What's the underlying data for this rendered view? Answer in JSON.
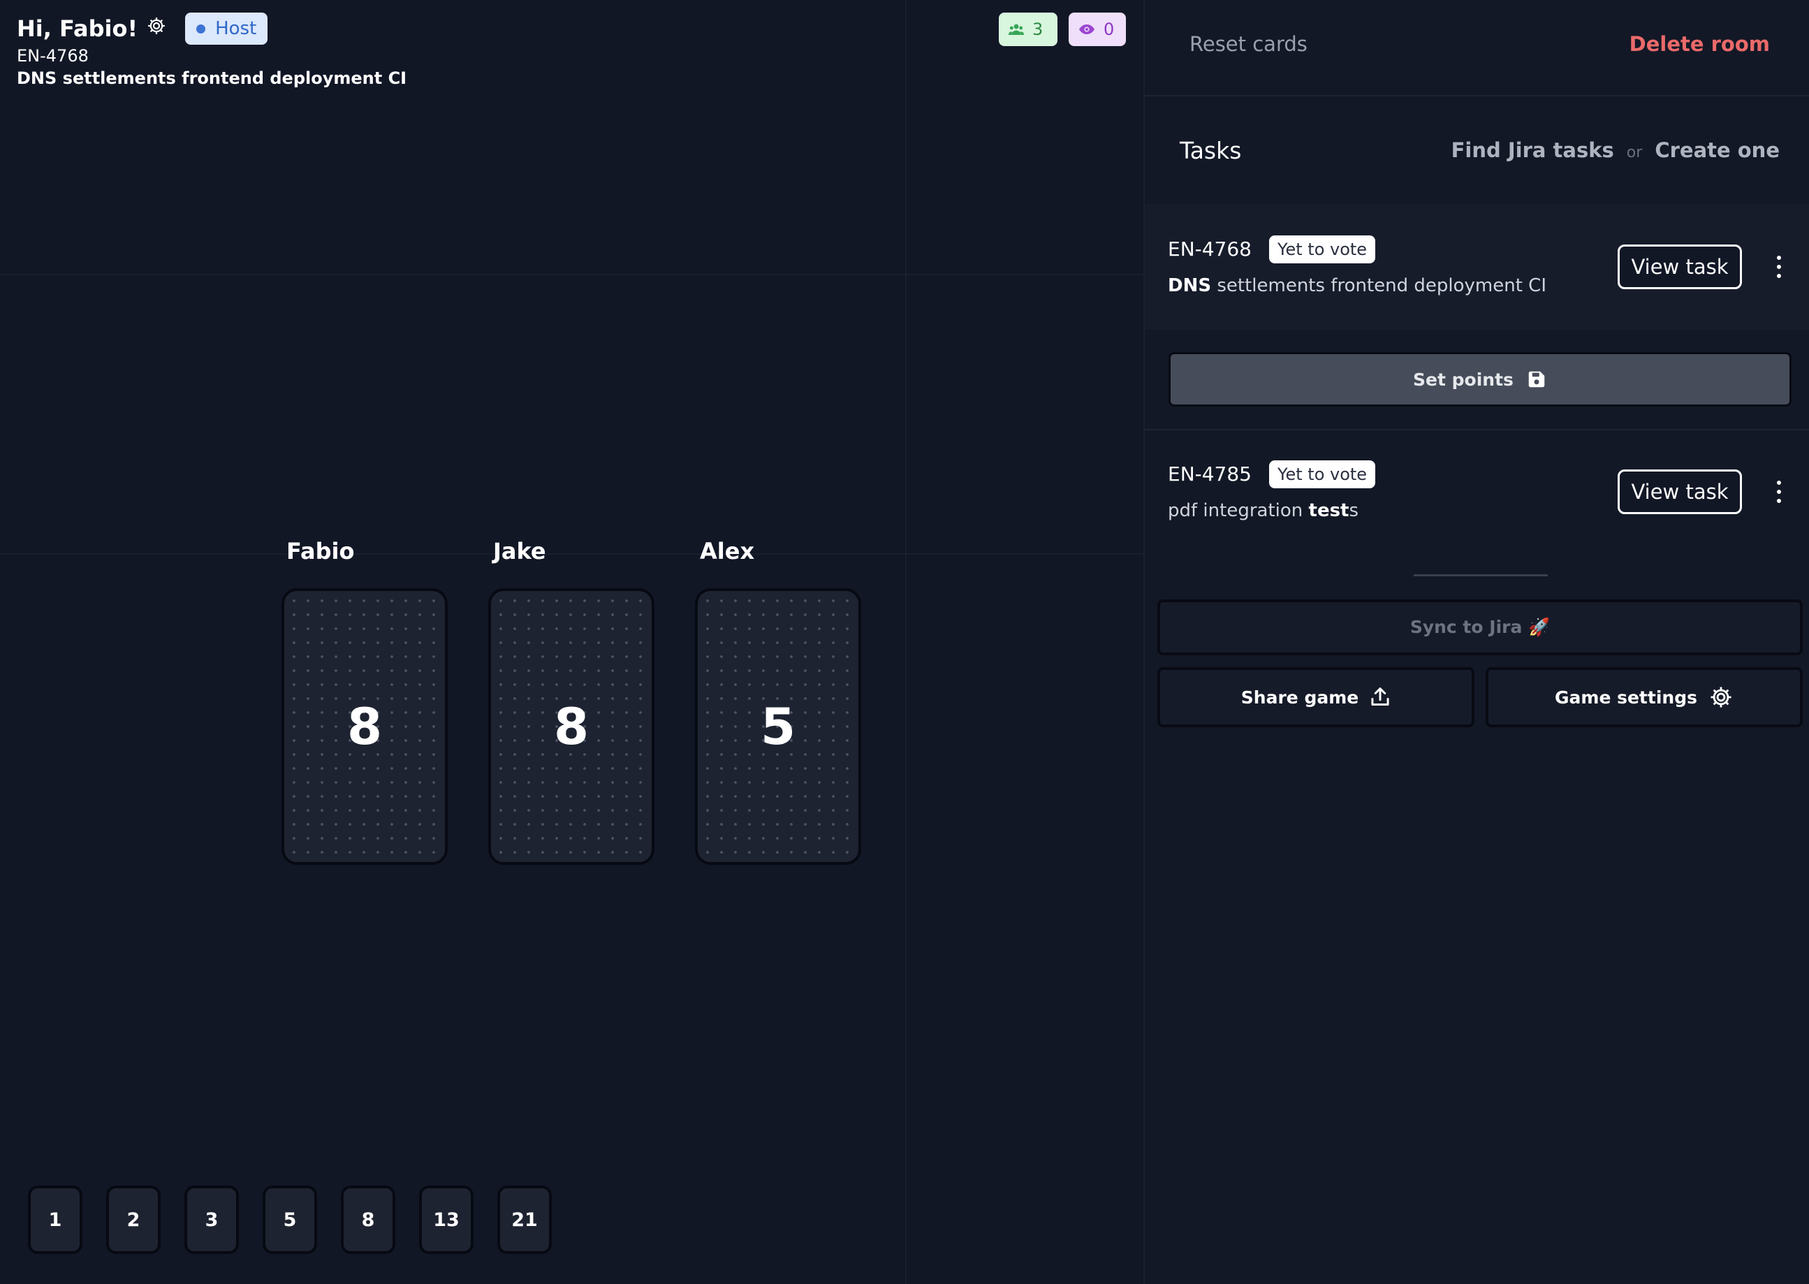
{
  "header": {
    "greeting": "Hi, Fabio!",
    "host_label": "Host",
    "task_key": "EN-4768",
    "task_title_bold": "DNS",
    "task_title_rest": " settlements frontend deployment CI",
    "players_count": "3",
    "viewers_count": "0"
  },
  "players": [
    {
      "name": "Fabio",
      "card": "8"
    },
    {
      "name": "Jake",
      "card": "8"
    },
    {
      "name": "Alex",
      "card": "5"
    }
  ],
  "deck": [
    "1",
    "2",
    "3",
    "5",
    "8",
    "13",
    "21"
  ],
  "panel": {
    "reset_label": "Reset cards",
    "delete_label": "Delete room",
    "tasks_heading": "Tasks",
    "find_jira_label": "Find Jira tasks",
    "or_label": "or",
    "create_label": "Create one",
    "tasks": [
      {
        "key": "EN-4768",
        "status": "Yet to vote",
        "title_bold": "DNS",
        "title_rest": " settlements frontend deployment CI",
        "view_label": "View task"
      },
      {
        "key": "EN-4785",
        "status": "Yet to vote",
        "title_pre": "pdf integration ",
        "title_bold": "test",
        "title_post": "s",
        "view_label": "View task"
      }
    ],
    "set_points_label": "Set points",
    "sync_label": "Sync to Jira 🚀",
    "share_label": "Share game",
    "settings_label": "Game settings"
  },
  "colors": {
    "background": "#121726",
    "delete": "#ea6a6a",
    "host_badge_bg": "#dce8fb",
    "host_badge_text": "#3068c8",
    "players_badge_bg": "#d8f5dd",
    "viewers_badge_bg": "#efdffa",
    "card_bg": "#1e2331",
    "set_points_bg": "#464c59"
  }
}
